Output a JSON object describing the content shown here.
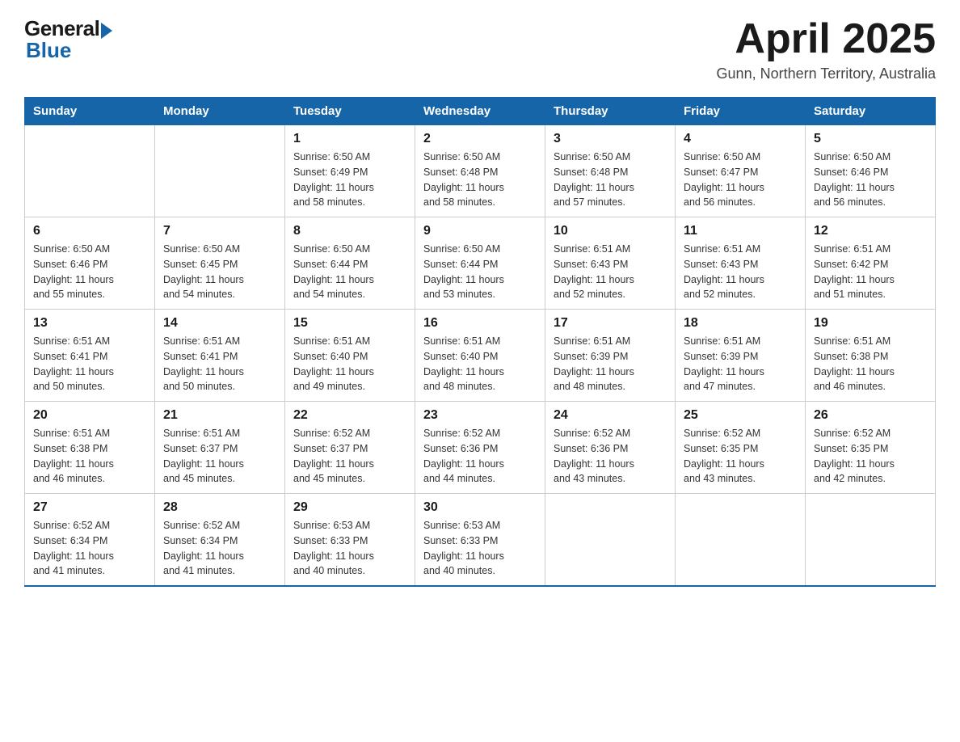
{
  "header": {
    "logo_general": "General",
    "logo_blue": "Blue",
    "month_title": "April 2025",
    "location": "Gunn, Northern Territory, Australia"
  },
  "days_of_week": [
    "Sunday",
    "Monday",
    "Tuesday",
    "Wednesday",
    "Thursday",
    "Friday",
    "Saturday"
  ],
  "weeks": [
    [
      {
        "day": "",
        "info": ""
      },
      {
        "day": "",
        "info": ""
      },
      {
        "day": "1",
        "info": "Sunrise: 6:50 AM\nSunset: 6:49 PM\nDaylight: 11 hours\nand 58 minutes."
      },
      {
        "day": "2",
        "info": "Sunrise: 6:50 AM\nSunset: 6:48 PM\nDaylight: 11 hours\nand 58 minutes."
      },
      {
        "day": "3",
        "info": "Sunrise: 6:50 AM\nSunset: 6:48 PM\nDaylight: 11 hours\nand 57 minutes."
      },
      {
        "day": "4",
        "info": "Sunrise: 6:50 AM\nSunset: 6:47 PM\nDaylight: 11 hours\nand 56 minutes."
      },
      {
        "day": "5",
        "info": "Sunrise: 6:50 AM\nSunset: 6:46 PM\nDaylight: 11 hours\nand 56 minutes."
      }
    ],
    [
      {
        "day": "6",
        "info": "Sunrise: 6:50 AM\nSunset: 6:46 PM\nDaylight: 11 hours\nand 55 minutes."
      },
      {
        "day": "7",
        "info": "Sunrise: 6:50 AM\nSunset: 6:45 PM\nDaylight: 11 hours\nand 54 minutes."
      },
      {
        "day": "8",
        "info": "Sunrise: 6:50 AM\nSunset: 6:44 PM\nDaylight: 11 hours\nand 54 minutes."
      },
      {
        "day": "9",
        "info": "Sunrise: 6:50 AM\nSunset: 6:44 PM\nDaylight: 11 hours\nand 53 minutes."
      },
      {
        "day": "10",
        "info": "Sunrise: 6:51 AM\nSunset: 6:43 PM\nDaylight: 11 hours\nand 52 minutes."
      },
      {
        "day": "11",
        "info": "Sunrise: 6:51 AM\nSunset: 6:43 PM\nDaylight: 11 hours\nand 52 minutes."
      },
      {
        "day": "12",
        "info": "Sunrise: 6:51 AM\nSunset: 6:42 PM\nDaylight: 11 hours\nand 51 minutes."
      }
    ],
    [
      {
        "day": "13",
        "info": "Sunrise: 6:51 AM\nSunset: 6:41 PM\nDaylight: 11 hours\nand 50 minutes."
      },
      {
        "day": "14",
        "info": "Sunrise: 6:51 AM\nSunset: 6:41 PM\nDaylight: 11 hours\nand 50 minutes."
      },
      {
        "day": "15",
        "info": "Sunrise: 6:51 AM\nSunset: 6:40 PM\nDaylight: 11 hours\nand 49 minutes."
      },
      {
        "day": "16",
        "info": "Sunrise: 6:51 AM\nSunset: 6:40 PM\nDaylight: 11 hours\nand 48 minutes."
      },
      {
        "day": "17",
        "info": "Sunrise: 6:51 AM\nSunset: 6:39 PM\nDaylight: 11 hours\nand 48 minutes."
      },
      {
        "day": "18",
        "info": "Sunrise: 6:51 AM\nSunset: 6:39 PM\nDaylight: 11 hours\nand 47 minutes."
      },
      {
        "day": "19",
        "info": "Sunrise: 6:51 AM\nSunset: 6:38 PM\nDaylight: 11 hours\nand 46 minutes."
      }
    ],
    [
      {
        "day": "20",
        "info": "Sunrise: 6:51 AM\nSunset: 6:38 PM\nDaylight: 11 hours\nand 46 minutes."
      },
      {
        "day": "21",
        "info": "Sunrise: 6:51 AM\nSunset: 6:37 PM\nDaylight: 11 hours\nand 45 minutes."
      },
      {
        "day": "22",
        "info": "Sunrise: 6:52 AM\nSunset: 6:37 PM\nDaylight: 11 hours\nand 45 minutes."
      },
      {
        "day": "23",
        "info": "Sunrise: 6:52 AM\nSunset: 6:36 PM\nDaylight: 11 hours\nand 44 minutes."
      },
      {
        "day": "24",
        "info": "Sunrise: 6:52 AM\nSunset: 6:36 PM\nDaylight: 11 hours\nand 43 minutes."
      },
      {
        "day": "25",
        "info": "Sunrise: 6:52 AM\nSunset: 6:35 PM\nDaylight: 11 hours\nand 43 minutes."
      },
      {
        "day": "26",
        "info": "Sunrise: 6:52 AM\nSunset: 6:35 PM\nDaylight: 11 hours\nand 42 minutes."
      }
    ],
    [
      {
        "day": "27",
        "info": "Sunrise: 6:52 AM\nSunset: 6:34 PM\nDaylight: 11 hours\nand 41 minutes."
      },
      {
        "day": "28",
        "info": "Sunrise: 6:52 AM\nSunset: 6:34 PM\nDaylight: 11 hours\nand 41 minutes."
      },
      {
        "day": "29",
        "info": "Sunrise: 6:53 AM\nSunset: 6:33 PM\nDaylight: 11 hours\nand 40 minutes."
      },
      {
        "day": "30",
        "info": "Sunrise: 6:53 AM\nSunset: 6:33 PM\nDaylight: 11 hours\nand 40 minutes."
      },
      {
        "day": "",
        "info": ""
      },
      {
        "day": "",
        "info": ""
      },
      {
        "day": "",
        "info": ""
      }
    ]
  ]
}
